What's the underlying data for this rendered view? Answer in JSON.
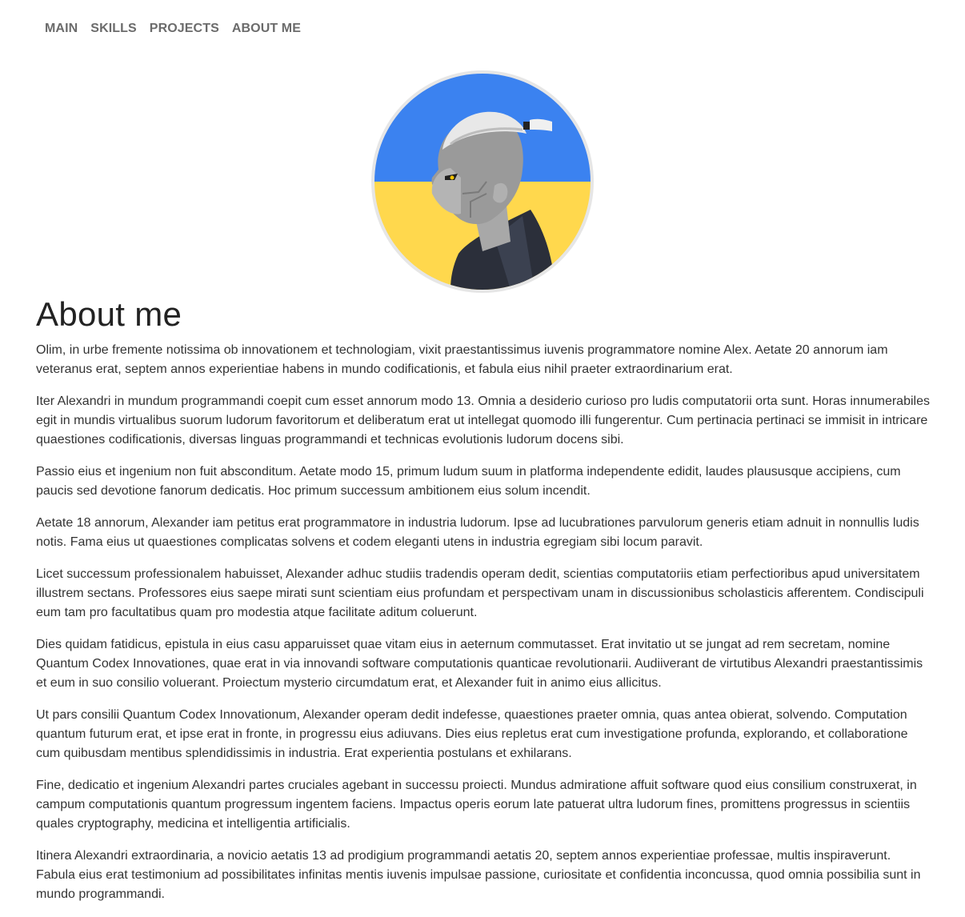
{
  "nav": {
    "items": [
      "MAIN",
      "SKILLS",
      "PROJECTS",
      "ABOUT ME"
    ]
  },
  "colors": {
    "flag_blue": "#3b82f0",
    "flag_yellow": "#ffd84d",
    "nav_text": "#6b6b6b",
    "text": "#333333"
  },
  "about": {
    "title": "About me",
    "paragraphs": [
      "Olim, in urbe fremente notissima ob innovationem et technologiam, vixit praestantissimus iuvenis programmatore nomine Alex. Aetate 20 annorum iam veteranus erat, septem annos experientiae habens in mundo codificationis, et fabula eius nihil praeter extraordinarium erat.",
      "Iter Alexandri in mundum programmandi coepit cum esset annorum modo 13. Omnia a desiderio curioso pro ludis computatorii orta sunt. Horas innumerabiles egit in mundis virtualibus suorum ludorum favoritorum et deliberatum erat ut intellegat quomodo illi fungerentur. Cum pertinacia pertinaci se immisit in intricare quaestiones codificationis, diversas linguas programmandi et technicas evolutionis ludorum docens sibi.",
      "Passio eius et ingenium non fuit absconditum. Aetate modo 15, primum ludum suum in platforma independente edidit, laudes plaususque accipiens, cum paucis sed devotione fanorum dedicatis. Hoc primum successum ambitionem eius solum incendit.",
      "Aetate 18 annorum, Alexander iam petitus erat programmatore in industria ludorum. Ipse ad lucubrationes parvulorum generis etiam adnuit in nonnullis ludis notis. Fama eius ut quaestiones complicatas solvens et codem eleganti utens in industria egregiam sibi locum paravit.",
      "Licet successum professionalem habuisset, Alexander adhuc studiis tradendis operam dedit, scientias computatoriis etiam perfectioribus apud universitatem illustrem sectans. Professores eius saepe mirati sunt scientiam eius profundam et perspectivam unam in discussionibus scholasticis afferentem. Condiscipuli eum tam pro facultatibus quam pro modestia atque facilitate aditum coluerunt.",
      "Dies quidam fatidicus, epistula in eius casu apparuisset quae vitam eius in aeternum commutasset. Erat invitatio ut se jungat ad rem secretam, nomine Quantum Codex Innovationes, quae erat in via innovandi software computationis quanticae revolutionarii. Audiiverant de virtutibus Alexandri praestantissimis et eum in suo consilio voluerant. Proiectum mysterio circumdatum erat, et Alexander fuit in animo eius allicitus.",
      "Ut pars consilii Quantum Codex Innovationum, Alexander operam dedit indefesse, quaestiones praeter omnia, quas antea obierat, solvendo. Computation quantum futurum erat, et ipse erat in fronte, in progressu eius adiuvans. Dies eius repletus erat cum investigatione profunda, explorando, et collaboratione cum quibusdam mentibus splendidissimis in industria. Erat experientia postulans et exhilarans.",
      "Fine, dedicatio et ingenium Alexandri partes cruciales agebant in successu proiecti. Mundus admiratione affuit software quod eius consilium construxerat, in campum computationis quantum progressum ingentem faciens. Impactus operis eorum late patuerat ultra ludorum fines, promittens progressus in scientiis quales cryptography, medicina et intelligentia artificialis.",
      "Itinera Alexandri extraordinaria, a novicio aetatis 13 ad prodigium programmandi aetatis 20, septem annos experientiae professae, multis inspiraverunt. Fabula eius erat testimonium ad possibilitates infinitas mentis iuvenis impulsae passione, curiositate et confidentia inconcussa, quod omnia possibilia sunt in mundo programmandi."
    ]
  }
}
